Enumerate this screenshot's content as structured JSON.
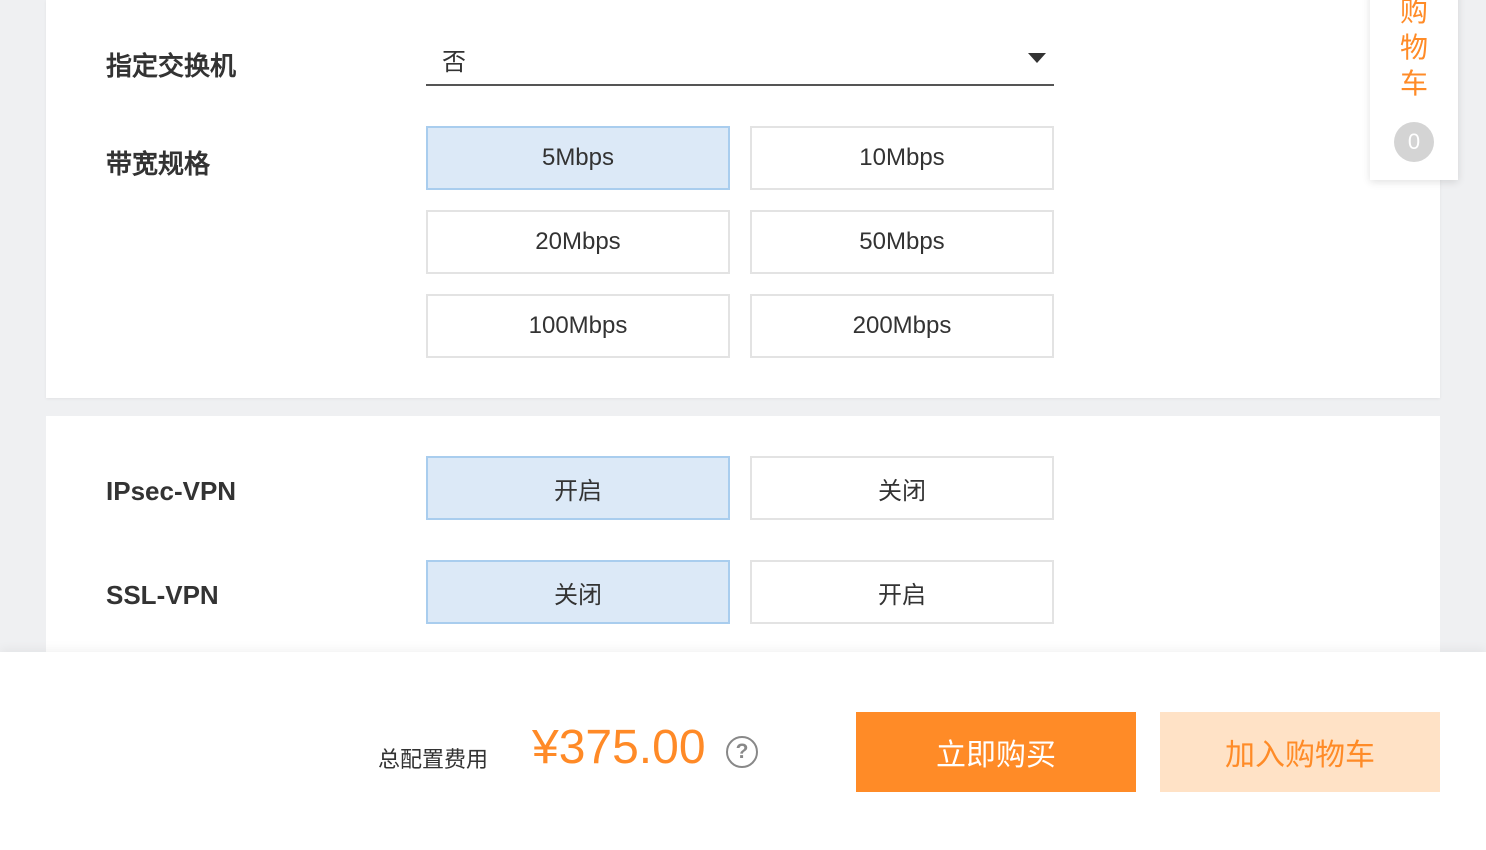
{
  "switch_row": {
    "label": "指定交换机",
    "select_value": "否"
  },
  "bandwidth_row": {
    "label": "带宽规格",
    "options": [
      "5Mbps",
      "10Mbps",
      "20Mbps",
      "50Mbps",
      "100Mbps",
      "200Mbps"
    ],
    "selected": "5Mbps"
  },
  "ipsec_row": {
    "label": "IPsec-VPN",
    "options": [
      "开启",
      "关闭"
    ],
    "selected": "开启"
  },
  "ssl_row": {
    "label": "SSL-VPN",
    "options": [
      "关闭",
      "开启"
    ],
    "selected": "关闭"
  },
  "footer": {
    "total_label": "总配置费用",
    "price": "¥375.00",
    "help_icon": "question-circle-icon",
    "buy_label": "立即购买",
    "cart_label": "加入购物车"
  },
  "side_cart": {
    "label": "购物车",
    "count": "0"
  },
  "colors": {
    "accent_orange": "#ff8b27",
    "selected_bg": "#dce9f7",
    "selected_border": "#a9cdee",
    "cart_button_bg": "#ffe2c6"
  }
}
